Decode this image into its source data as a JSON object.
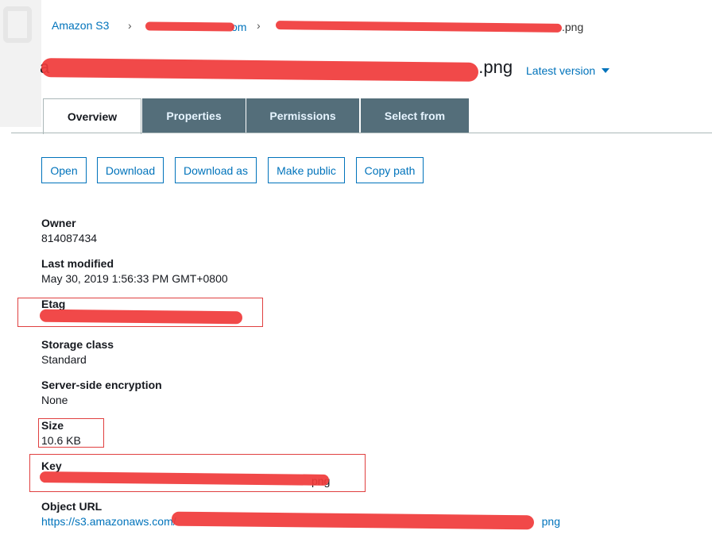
{
  "breadcrumb": {
    "root": "Amazon S3",
    "bucket_suffix": "om",
    "object_suffix": ".png"
  },
  "header": {
    "title_prefix": "a",
    "title_suffix": ".png",
    "version": "Latest version"
  },
  "tabs": [
    {
      "label": "Overview",
      "active": true
    },
    {
      "label": "Properties",
      "active": false
    },
    {
      "label": "Permissions",
      "active": false
    },
    {
      "label": "Select from",
      "active": false
    }
  ],
  "actions": {
    "open": "Open",
    "download": "Download",
    "download_as": "Download as",
    "make_public": "Make public",
    "copy_path": "Copy path"
  },
  "properties": {
    "owner": {
      "label": "Owner",
      "value": "814087434"
    },
    "last_modified": {
      "label": "Last modified",
      "value": "May 30, 2019 1:56:33 PM GMT+0800"
    },
    "etag": {
      "label": "Etag",
      "value": ""
    },
    "storage_class": {
      "label": "Storage class",
      "value": "Standard"
    },
    "encryption": {
      "label": "Server-side encryption",
      "value": "None"
    },
    "size": {
      "label": "Size",
      "value": "10.6 KB"
    },
    "key": {
      "label": "Key",
      "value_suffix": "png"
    },
    "object_url": {
      "label": "Object URL",
      "value_prefix": "https://s3.amazonaws.com/",
      "value_suffix": "png"
    }
  },
  "colors": {
    "link": "#0073bb",
    "tab_inactive": "#546e7a",
    "highlight": "#e04040",
    "redaction": "#f03a3a"
  }
}
